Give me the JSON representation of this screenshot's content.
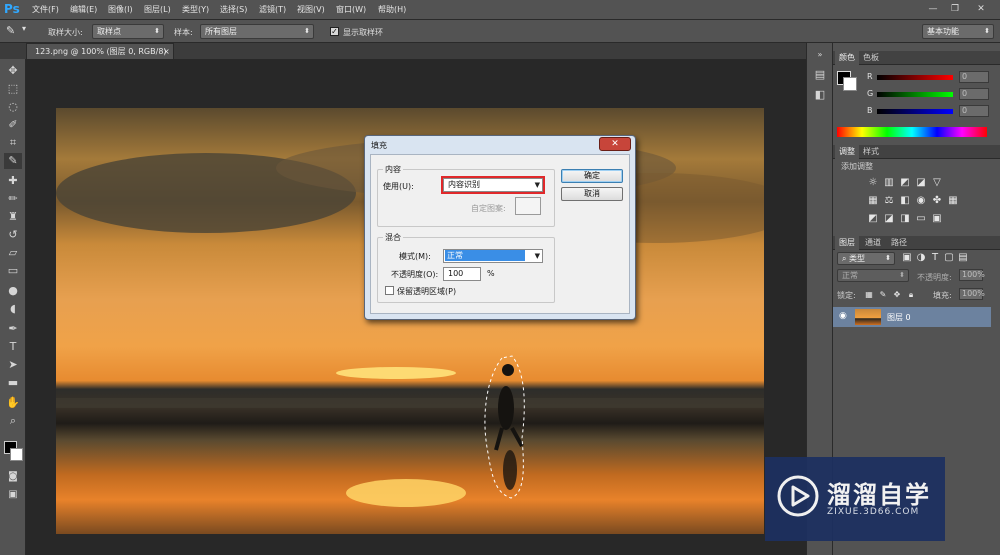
{
  "app": {
    "logo": "Ps"
  },
  "menu": [
    "文件(F)",
    "编辑(E)",
    "图像(I)",
    "图层(L)",
    "类型(Y)",
    "选择(S)",
    "滤镜(T)",
    "视图(V)",
    "窗口(W)",
    "帮助(H)"
  ],
  "window_controls": {
    "minimize": "—",
    "restore": "❐",
    "close": "✕"
  },
  "options_bar": {
    "sample_size_label": "取样大小:",
    "sample_size_value": "取样点",
    "sample_label": "样本:",
    "sample_value": "所有图层",
    "show_ring_label": "显示取样环",
    "show_ring_checked": true,
    "workspace": "基本功能"
  },
  "document_tab": {
    "title": "123.png @ 100% (图层 0, RGB/8)",
    "close": "×"
  },
  "fill_dialog": {
    "title": "填充",
    "close": "✕",
    "contents_group": "内容",
    "use_label": "使用(U):",
    "use_value": "内容识别",
    "custom_pattern_label": "自定图案:",
    "blending_group": "混合",
    "mode_label": "模式(M):",
    "mode_value": "正常",
    "opacity_label": "不透明度(O):",
    "opacity_value": "100",
    "opacity_unit": "%",
    "preserve_label": "保留透明区域(P)",
    "ok": "确定",
    "cancel": "取消"
  },
  "color_panel": {
    "tabs": [
      "颜色",
      "色板"
    ],
    "channels": [
      {
        "label": "R",
        "value": "0"
      },
      {
        "label": "G",
        "value": "0"
      },
      {
        "label": "B",
        "value": "0"
      }
    ]
  },
  "adjustments_panel": {
    "tabs": [
      "调整",
      "样式"
    ],
    "heading": "添加调整"
  },
  "layers_panel": {
    "tabs": [
      "图层",
      "通道",
      "路径"
    ],
    "filter_kind": "类型",
    "blend_mode": "正常",
    "opacity_label": "不透明度:",
    "opacity_value": "100%",
    "lock_label": "锁定:",
    "fill_label": "填充:",
    "fill_value": "100%",
    "layers": [
      {
        "name": "图层 0",
        "visible": true
      }
    ]
  },
  "watermark": {
    "title": "溜溜自学",
    "url": "ZIXUE.3D66.COM"
  }
}
